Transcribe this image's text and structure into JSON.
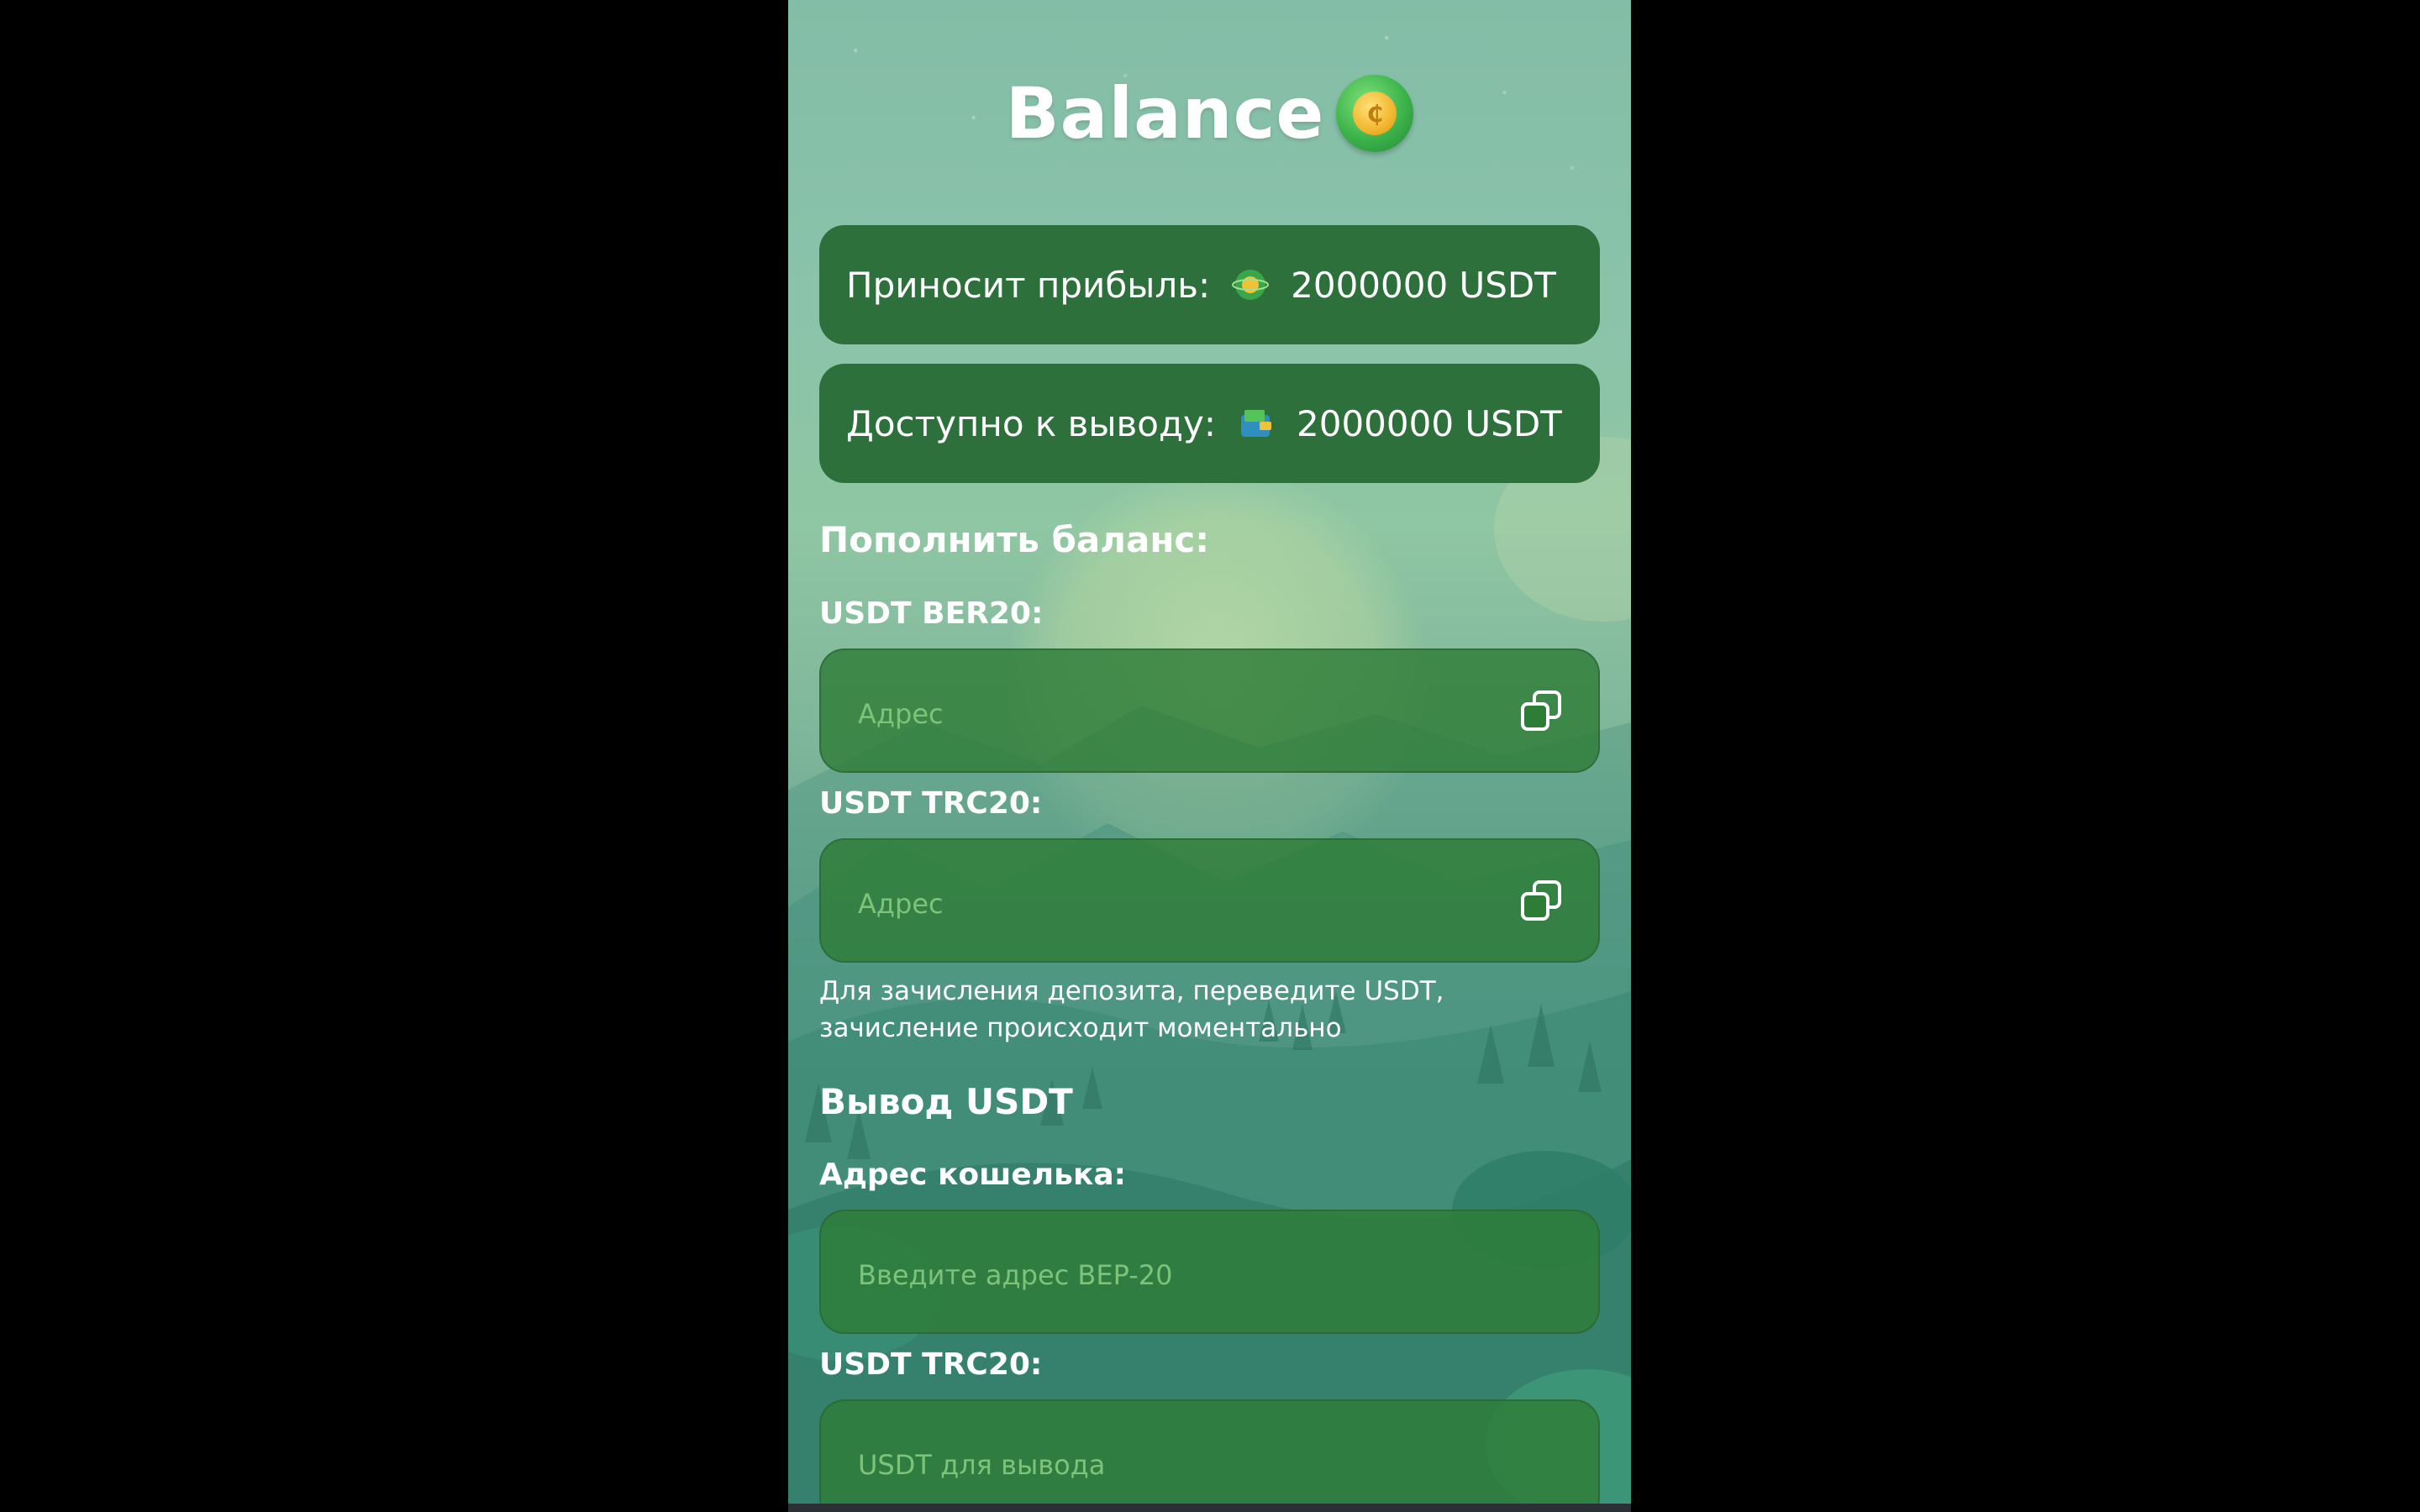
{
  "header": {
    "title": "Balance",
    "coin_icon": "coin-icon"
  },
  "stats": {
    "profit": {
      "label": "Приносит прибыль:",
      "icon": "planet-coin-icon",
      "value": "2000000 USDT"
    },
    "available": {
      "label": "Доступно к выводу:",
      "icon": "wallet-icon",
      "value": "2000000 USDT"
    }
  },
  "deposit": {
    "heading": "Пополнить баланс:",
    "ber20_label": "USDT BER20:",
    "ber20_placeholder": "Адрес",
    "trc20_label": "USDT TRC20:",
    "trc20_placeholder": "Адрес",
    "copy_icon": "copy-icon",
    "helper": "Для зачисления депозита, переведите USDT, зачисление происходит моментально"
  },
  "withdraw": {
    "heading": "Вывод USDT",
    "wallet_label": "Адрес кошелька:",
    "wallet_placeholder": "Введите адрес BEP-20",
    "trc20_label": "USDT TRC20:",
    "trc20_placeholder": "USDT для вывода"
  },
  "colors": {
    "card_bg": "#2e703c",
    "input_bg": "#2e7d37",
    "placeholder": "#7dc47a",
    "accent_coin": "#f2b62f"
  }
}
